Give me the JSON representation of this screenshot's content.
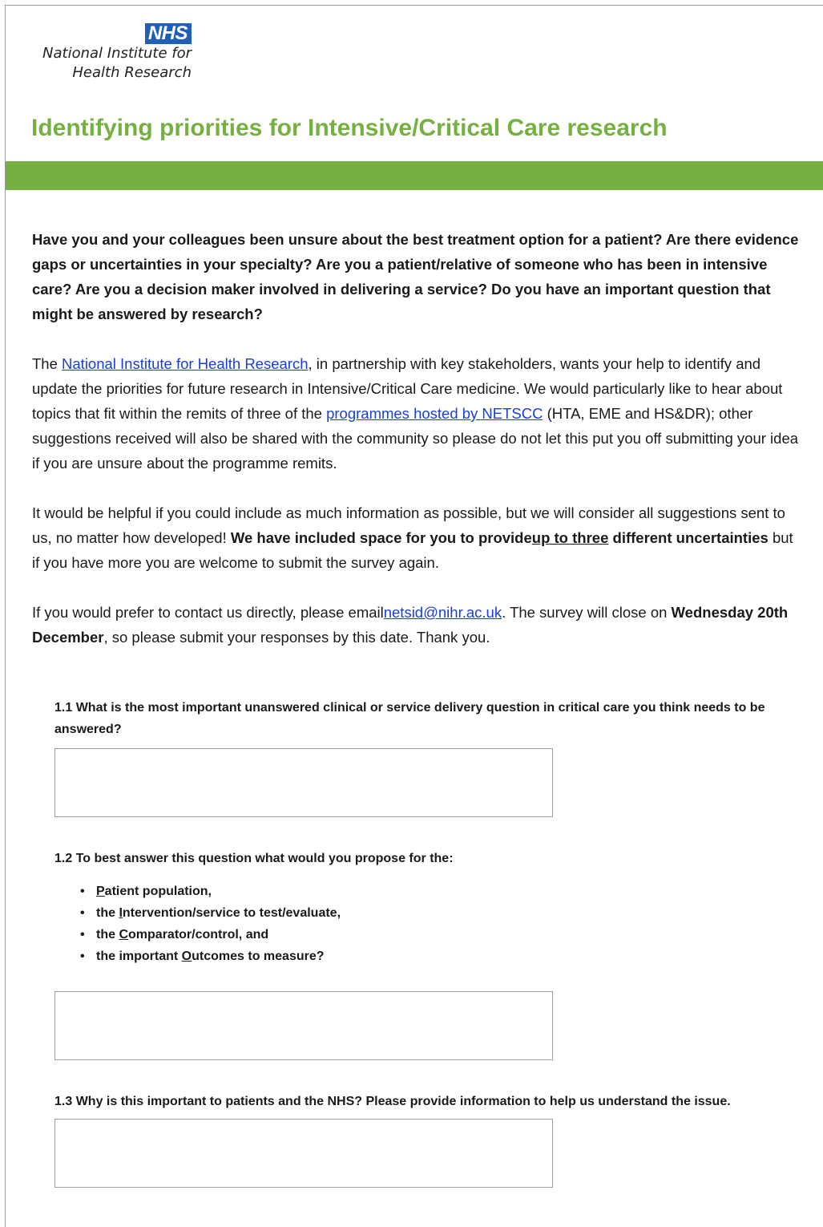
{
  "logo": {
    "badge": "NHS",
    "line1": "National Institute for",
    "line2": "Health Research"
  },
  "title": "Identifying priorities for Intensive/Critical Care research",
  "intro_question": "Have you and your colleagues been unsure about the best treatment option for a patient? Are there evidence gaps or uncertainties in your specialty? Are you a patient/relative of someone who has been in intensive care? Are you a decision maker involved in delivering a service? Do you have an important question that might be answered by research?",
  "para2": {
    "t1": "The ",
    "link1": "National Institute for Health Research",
    "t2": ", in partnership with key stakeholders, wants your help to identify and update the priorities for future research in Intensive/Critical Care medicine. We would particularly like to hear about topics that fit within the remits of three of the ",
    "link2": "programmes hosted by NETSCC",
    "t3": " (HTA, EME and HS&DR); other suggestions received will also be shared with the community so please do not let this put you off submitting your idea if you are unsure about the programme remits."
  },
  "para3": {
    "t1": "It would be helpful if you could include as much information as possible, but we will consider all suggestions sent to us, no matter how developed! ",
    "b1": "We have included space for you to provide",
    "bu": "up to three",
    "b2": " different uncertainties",
    "t2": " but if you have more you are welcome to submit the survey again."
  },
  "para4": {
    "t1": "If you would prefer to contact us directly, please email",
    "email": "netsid@nihr.ac.uk",
    "t2": ". The survey will close on ",
    "date": "Wednesday 20th December",
    "t3": ", so please submit your responses by this date. Thank you."
  },
  "questions": {
    "q1": "1.1 What is the most important unanswered clinical or service delivery question in critical care you think needs to be answered?",
    "q2": "1.2 To best answer this question what would you propose for the:",
    "q2_items": [
      {
        "pre": "",
        "u": "P",
        "post": "atient population,"
      },
      {
        "pre": "the ",
        "u": "I",
        "post": "ntervention/service to test/evaluate,"
      },
      {
        "pre": "the ",
        "u": "C",
        "post": "omparator/control, and"
      },
      {
        "pre": "the important ",
        "u": "O",
        "post": "utcomes to measure?"
      }
    ],
    "q3": "1.3 Why is this important to patients and the NHS? Please provide information to help us understand the issue."
  },
  "colors": {
    "accent_green": "#76b041",
    "nhs_blue": "#1f5fb8",
    "link_blue": "#1a3fd6"
  }
}
